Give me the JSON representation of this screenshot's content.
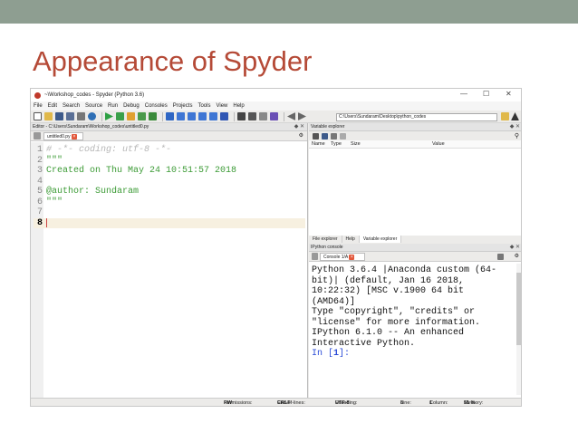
{
  "slide": {
    "title": "Appearance of Spyder"
  },
  "window": {
    "title": "~\\Workshop_codes - Spyder (Python 3.6)",
    "min": "—",
    "max": "☐",
    "close": "✕"
  },
  "menu": [
    "File",
    "Edit",
    "Search",
    "Source",
    "Run",
    "Debug",
    "Consoles",
    "Projects",
    "Tools",
    "View",
    "Help"
  ],
  "toolbar": {
    "path": "C:\\Users\\Sundaram\\Desktop\\python_codes"
  },
  "editor": {
    "header": "Editor - C:\\Users\\Sundaram\\Workshop_codes\\untitled0.py",
    "tab": "untitled0.py",
    "lines": [
      {
        "n": "1",
        "text": "# -*- coding: utf-8 -*-",
        "cls": "c-comment"
      },
      {
        "n": "2",
        "text": "\"\"\"",
        "cls": "c-green"
      },
      {
        "n": "3",
        "text": "Created on Thu May 24 10:51:57 2018",
        "cls": "c-green"
      },
      {
        "n": "4",
        "text": "",
        "cls": "c-green"
      },
      {
        "n": "5",
        "text": "@author: Sundaram",
        "cls": "c-green"
      },
      {
        "n": "6",
        "text": "\"\"\"",
        "cls": "c-green"
      },
      {
        "n": "7",
        "text": "",
        "cls": "c-green"
      },
      {
        "n": "8",
        "text": "",
        "cls": "c-green"
      }
    ]
  },
  "variable_explorer": {
    "header": "Variable explorer",
    "columns": [
      "Name",
      "Type",
      "Size",
      "Value"
    ]
  },
  "bottom_tabs": [
    "File explorer",
    "Help",
    "Variable explorer"
  ],
  "console": {
    "header": "IPython console",
    "tab": "Console 1/A",
    "lines": [
      "Python 3.6.4 |Anaconda custom (64-",
      "bit)| (default, Jan 16 2018,",
      "10:22:32) [MSC v.1900 64 bit",
      "(AMD64)]",
      "Type \"copyright\", \"credits\" or",
      "\"license\" for more information.",
      "",
      "IPython 6.1.0 -- An enhanced",
      "Interactive Python.",
      ""
    ],
    "prompt_pre": "In [",
    "prompt_num": "1",
    "prompt_post": "]:"
  },
  "status": {
    "permissions_label": "Permissions:",
    "permissions": "RW",
    "eol_label": "End-of-lines:",
    "eol": "CRLF",
    "encoding_label": "Encoding:",
    "encoding": "UTF-8",
    "line_label": "Line:",
    "line": "8",
    "column_label": "Column:",
    "column": "1",
    "memory_label": "Memory:",
    "memory": "51 %"
  }
}
